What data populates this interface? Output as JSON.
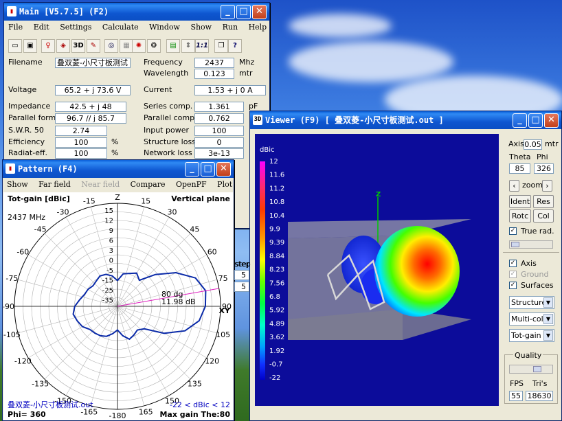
{
  "colors": {
    "titlebar": "#0b4fc4",
    "viewer_bg": "#0c0c9a",
    "pattern_curve": "#0a2aa8",
    "gain_line": "#e020c0"
  },
  "main": {
    "title": "Main [V5.7.5]   (F2)",
    "menu": [
      "File",
      "Edit",
      "Settings",
      "Calculate",
      "Window",
      "Show",
      "Run",
      "Help"
    ],
    "toolbar": [
      "open-icon",
      "save-icon",
      "antenna-icon",
      "cube-icon",
      "3D",
      "edit-icon",
      "target-icon",
      "grid-icon",
      "pattern-icon",
      "spin-icon",
      "calc-icon",
      "slider-icon",
      "1:1",
      "book-icon",
      "help-icon"
    ],
    "filename_label": "Filename",
    "filename": "叠双菱-小尺寸板测试",
    "frequency_label": "Frequency",
    "frequency": "2437",
    "frequency_unit": "Mhz",
    "wavelength_label": "Wavelength",
    "wavelength": "0.123",
    "wavelength_unit": "mtr",
    "voltage_label": "Voltage",
    "voltage": "65.2 + j 73.6 V",
    "current_label": "Current",
    "current": "1.53 + j 0 A",
    "impedance_label": "Impedance",
    "impedance": "42.5 + j 48",
    "series_label": "Series comp.",
    "series": "1.361",
    "series_unit": "pF",
    "parallel_form_label": "Parallel form",
    "parallel_form": "96.7 // j 85.7",
    "parallel_comp_label": "Parallel comp.",
    "parallel_comp": "0.762",
    "swr_label": "S.W.R. 50",
    "swr": "2.74",
    "input_power_label": "Input power",
    "input_power": "100",
    "efficiency_label": "Efficiency",
    "efficiency": "100",
    "pct": "%",
    "structure_loss_label": "Structure loss",
    "structure_loss": "0",
    "radiat_label": "Radiat-eff.",
    "radiat": "100",
    "network_loss_label": "Network loss",
    "network_loss": "3e-13",
    "step_label": "step",
    "step1": "5",
    "step2": "5"
  },
  "pattern": {
    "title": "Pattern    (F4)",
    "menu": [
      "Show",
      "Far field",
      "Near field",
      "Compare",
      "OpenPF",
      "Plot"
    ],
    "tot_gain": "Tot-gain [dBic]",
    "plane": "Vertical plane",
    "freq": "2437 MHz",
    "angle_labels": [
      {
        "t": "Z",
        "a": 0
      },
      {
        "t": "15",
        "a": 15
      },
      {
        "t": "30",
        "a": 30
      },
      {
        "t": "45",
        "a": 45
      },
      {
        "t": "60",
        "a": 60
      },
      {
        "t": "75",
        "a": 75
      },
      {
        "t": "90",
        "a": 90
      },
      {
        "t": "105",
        "a": 105
      },
      {
        "t": "120",
        "a": 120
      },
      {
        "t": "135",
        "a": 135
      },
      {
        "t": "150",
        "a": 150
      },
      {
        "t": "165",
        "a": 165
      },
      {
        "t": "-180",
        "a": 180
      },
      {
        "t": "-165",
        "a": 195
      },
      {
        "t": "-150",
        "a": 210
      },
      {
        "t": "-135",
        "a": 225
      },
      {
        "t": "-120",
        "a": 240
      },
      {
        "t": "-105",
        "a": 255
      },
      {
        "t": "-90",
        "a": 270
      },
      {
        "t": "-75",
        "a": 285
      },
      {
        "t": "-60",
        "a": 300
      },
      {
        "t": "-45",
        "a": 315
      },
      {
        "t": "-30",
        "a": 330
      },
      {
        "t": "-15",
        "a": 345
      }
    ],
    "xy_label": "XY",
    "ring_labels": [
      "15",
      "12",
      "9",
      "6",
      "3",
      "0",
      "-5",
      "-15",
      "-25",
      "-35"
    ],
    "marker_angle": "80 dg",
    "marker_gain": "11.98 dB",
    "file": "叠双菱-小尺寸板测试.out",
    "range": "-22 < dBic < 12",
    "phi": "Phi= 360",
    "maxgain": "Max gain The:80"
  },
  "viewer": {
    "title": "Viewer  (F9)     [  叠双菱-小尺寸板测试.out  ]",
    "unit": "dBic",
    "scale": [
      "12",
      "11.6",
      "11.2",
      "10.8",
      "10.4",
      "9.9",
      "9.39",
      "8.84",
      "8.23",
      "7.56",
      "6.8",
      "5.92",
      "4.89",
      "3.62",
      "1.92",
      "-0.7",
      "-22"
    ],
    "axis_label": "Axis",
    "axis_value": "0.05",
    "axis_unit": "mtr",
    "theta_label": "Theta",
    "phi_label": "Phi",
    "theta": "85",
    "phi": "326",
    "zoom": "zoom",
    "ident": "Ident",
    "res": "Res",
    "rotc": "Rotc",
    "col": "Col",
    "true_rad": "True rad.",
    "axis_chk": "Axis",
    "ground": "Ground",
    "surfaces": "Surfaces",
    "sel1": "Structure",
    "sel2": "Multi-colo",
    "sel3": "Tot-gain",
    "quality": "Quality",
    "fps_label": "FPS",
    "tris_label": "Tri's",
    "fps": "55",
    "tris": "18630",
    "z_axis": "Z"
  },
  "pattern_curve_db": [
    [
      0,
      -10
    ],
    [
      10,
      -3
    ],
    [
      20,
      -1
    ],
    [
      30,
      0.5
    ],
    [
      40,
      -2
    ],
    [
      50,
      3
    ],
    [
      60,
      7
    ],
    [
      70,
      10.5
    ],
    [
      80,
      11.98
    ],
    [
      90,
      11.6
    ],
    [
      100,
      10.5
    ],
    [
      110,
      8
    ],
    [
      120,
      4
    ],
    [
      130,
      -1
    ],
    [
      140,
      -5
    ],
    [
      150,
      -3
    ],
    [
      160,
      -1
    ],
    [
      170,
      -6
    ],
    [
      180,
      -12
    ],
    [
      190,
      -8
    ],
    [
      200,
      -4
    ],
    [
      210,
      -2
    ],
    [
      220,
      -1
    ],
    [
      230,
      0
    ],
    [
      240,
      1
    ],
    [
      250,
      1.5
    ],
    [
      260,
      2
    ],
    [
      270,
      1.5
    ],
    [
      280,
      0.5
    ],
    [
      290,
      -1
    ],
    [
      300,
      -2
    ],
    [
      310,
      -4
    ],
    [
      320,
      -3
    ],
    [
      330,
      -1
    ],
    [
      340,
      -2
    ],
    [
      350,
      -5
    ],
    [
      360,
      -10
    ]
  ]
}
